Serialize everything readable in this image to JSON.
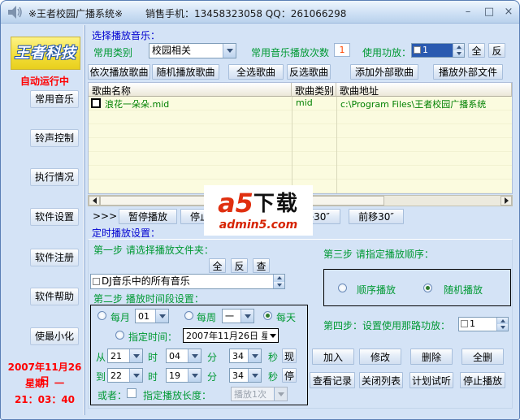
{
  "titlebar": {
    "title": "※王者校园广播系统※",
    "contact": "销售手机：13458323058 QQ：261066298",
    "minimize": "–",
    "maximize": "□",
    "close": "×"
  },
  "sidebar": {
    "logo": "王者科技",
    "status": "自动运行中",
    "buttons": [
      "常用音乐",
      "铃声控制",
      "执行情况",
      "软件设置",
      "软件注册",
      "软件帮助",
      "使最小化"
    ],
    "date": "2007年11月26日",
    "weekday": "星期：一",
    "time": "21：03：40"
  },
  "music": {
    "section_title": "选择播放音乐：",
    "category_label": "常用类别",
    "category_value": "校园相关",
    "play_count_label": "常用音乐播放次数",
    "play_count_value": "1",
    "amp_label": "使用功放：",
    "amp_value": "1",
    "select_all": "全",
    "invert": "反",
    "toolbar": [
      "依次播放歌曲",
      "随机播放歌曲",
      "全选歌曲",
      "反选歌曲",
      "添加外部歌曲",
      "播放外部文件"
    ]
  },
  "table": {
    "columns": [
      "歌曲名称",
      "歌曲类别",
      "歌曲地址"
    ],
    "rows": [
      {
        "name": "浪花一朵朵.mid",
        "type": "mid",
        "path": "c:\\Program Files\\王者校园广播系统"
      }
    ]
  },
  "transport": {
    "prefix": ">>>",
    "pause": "暂停播放",
    "stop": "停止播放",
    "back": "后移30″",
    "forward": "前移30″"
  },
  "timer": {
    "section_title": "定时播放设置：",
    "step1_label": "第一步 请选择播放文件夹：",
    "all": "全",
    "invert": "反",
    "query": "查",
    "folder_value": "DJ音乐中的所有音乐",
    "step2_label": "第二步 播放时间段设置：",
    "monthly_label": "每月",
    "monthly_value": "01",
    "weekly_label": "每周",
    "weekly_value": "一",
    "daily_label": "每天",
    "specific_label": "指定时间：",
    "specific_value": "2007年11月26日 星",
    "from_label": "从",
    "to_label": "到",
    "hour_label": "时",
    "minute_label": "分",
    "second_label": "秒",
    "from": {
      "h": "21",
      "m": "04",
      "s": "34"
    },
    "to": {
      "h": "22",
      "m": "19",
      "s": "34"
    },
    "now_btn": "现",
    "stopnow_btn": "停",
    "or_label": "或者：",
    "length_label": "指定播放长度：",
    "length_value": "播放1次",
    "step3_label": "第三步 请指定播放顺序：",
    "order_seq": "顺序播放",
    "order_random": "随机播放",
    "step4_label": "第四步：设置使用那路功放：",
    "step4_value": "1",
    "actions": [
      "加入",
      "修改",
      "删除",
      "全删",
      "查看记录",
      "关闭列表",
      "计划试听",
      "停止播放"
    ]
  },
  "watermark": {
    "logo": "a5",
    "text": "下载",
    "domain": "admin5.com"
  },
  "colors": {
    "label_green": "#009933",
    "label_blue": "#0000d0",
    "alert_red": "#ff0000",
    "value_orange": "#ff4400",
    "highlight_blue": "#2a5ab0",
    "logo_yellow": "#f2dd36",
    "table_bg": "#fbfbdf",
    "watermark_red": "#d62300"
  }
}
